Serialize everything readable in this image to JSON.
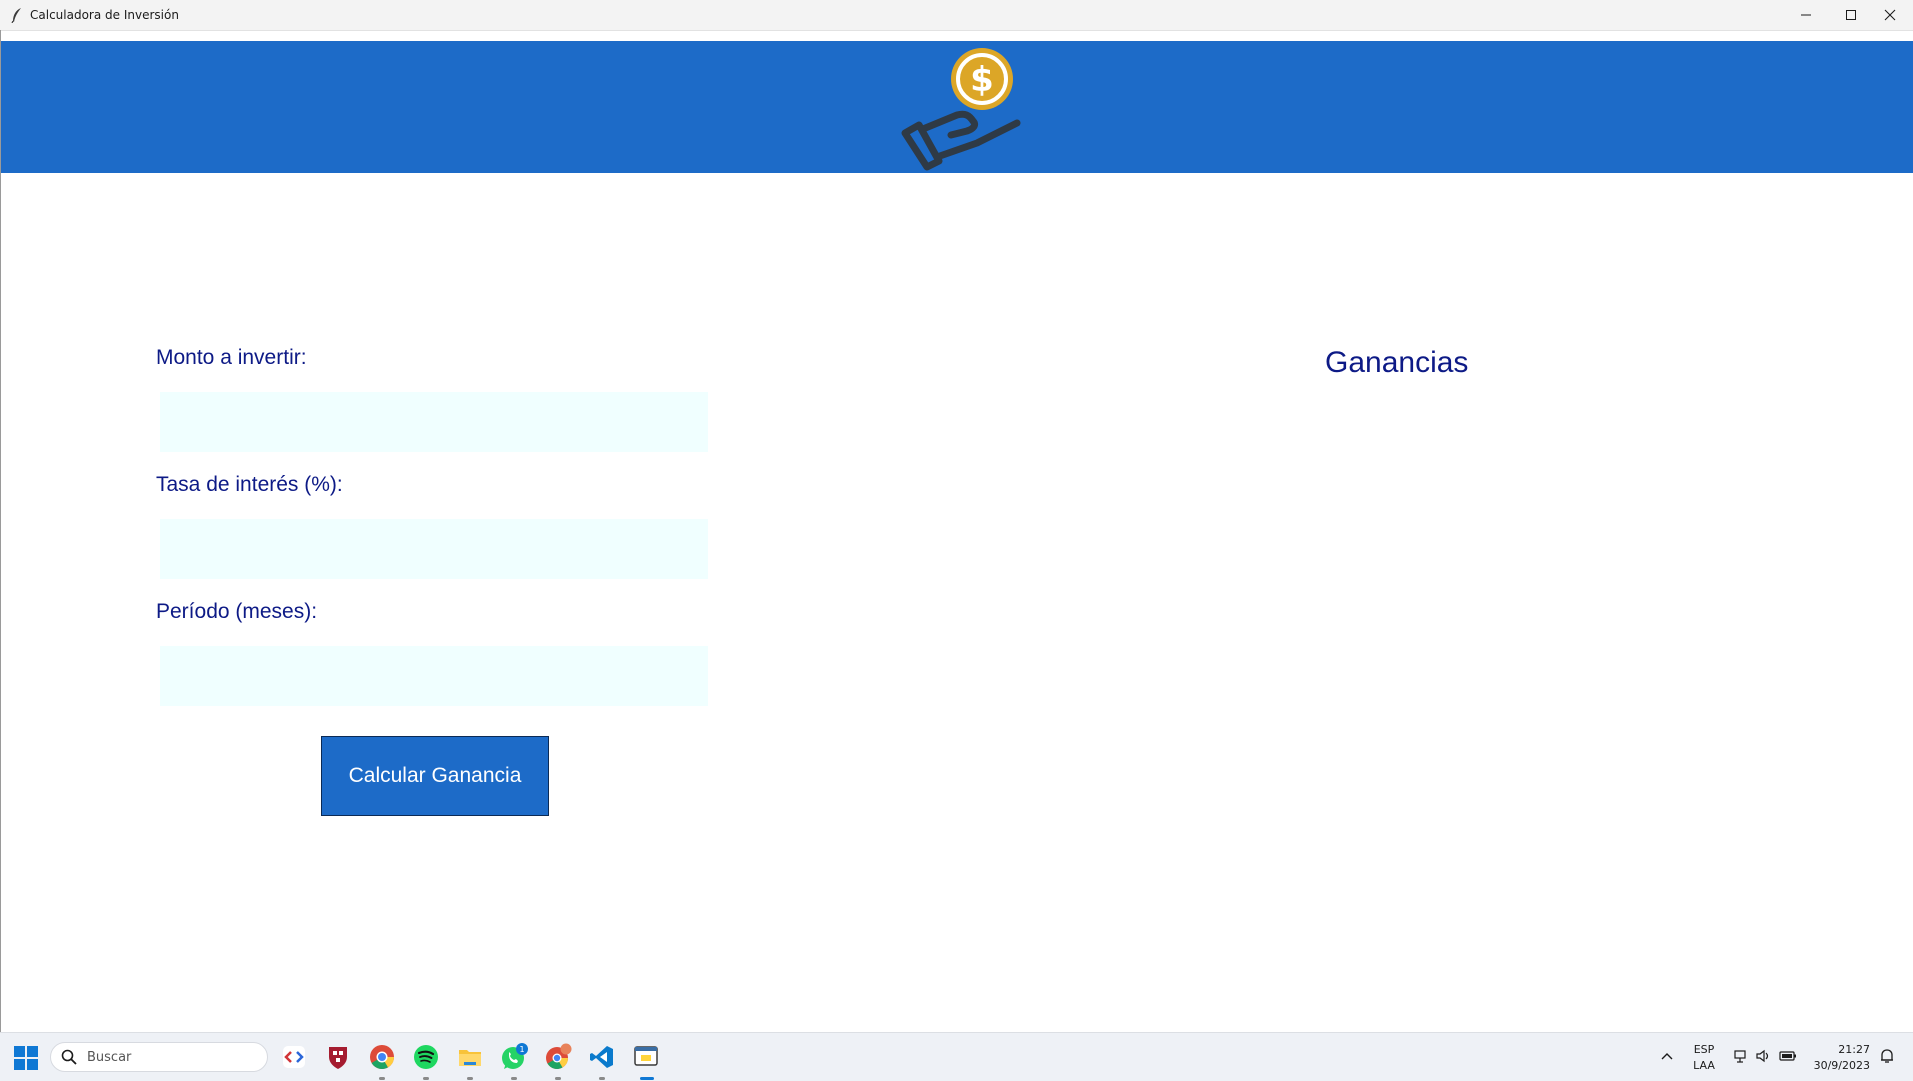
{
  "window": {
    "title": "Calculadora de Inversión"
  },
  "header": {
    "logo_icon": "hand-holding-dollar-coin-icon",
    "brand_color": "#1d6bc8",
    "coin_color": "#dca627"
  },
  "form": {
    "monto_label": "Monto a invertir:",
    "monto_value": "",
    "tasa_label": "Tasa de interés (%):",
    "tasa_value": "",
    "periodo_label": "Período (meses):",
    "periodo_value": "",
    "calculate_button": "Calcular Ganancia",
    "field_background": "#f0ffff",
    "label_color": "#0d1a86"
  },
  "results": {
    "title": "Ganancias"
  },
  "taskbar": {
    "search_placeholder": "Buscar",
    "apps": [
      "devtoys-icon",
      "harvard-shield-icon",
      "chrome-icon",
      "spotify-icon",
      "file-explorer-icon",
      "whatsapp-icon",
      "chrome-profile-icon",
      "vscode-icon",
      "python-app-icon"
    ],
    "whatsapp_badge": "1",
    "language_top": "ESP",
    "language_bottom": "LAA",
    "time": "21:27",
    "date": "30/9/2023"
  }
}
